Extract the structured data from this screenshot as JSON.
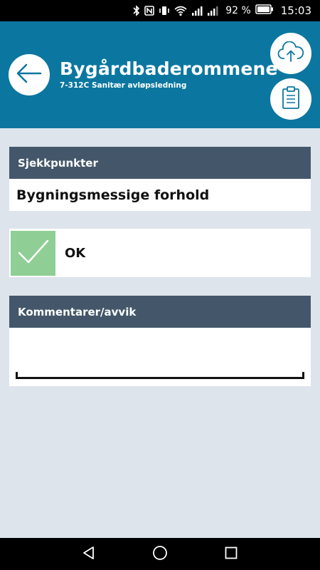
{
  "status_bar": {
    "battery_percent": "92 %",
    "time": "15:03",
    "icons": [
      "bluetooth-icon",
      "nfc-icon",
      "vibrate-icon",
      "wifi-icon",
      "signal-icon",
      "signal-icon",
      "battery-icon"
    ]
  },
  "header": {
    "title": "Bygårdbaderommene",
    "subtitle": "7-312C Sanitær avløpsledning",
    "background": "#0b77a0"
  },
  "checkpoints": {
    "header": "Sjekkpunkter",
    "value": "Bygningsmessige forhold"
  },
  "status": {
    "label": "OK",
    "check_color": "#8fcf95"
  },
  "comments": {
    "header": "Kommentarer/avvik",
    "value": ""
  },
  "nav_bar": {
    "buttons": [
      "back-icon",
      "home-icon",
      "recent-apps-icon"
    ]
  }
}
